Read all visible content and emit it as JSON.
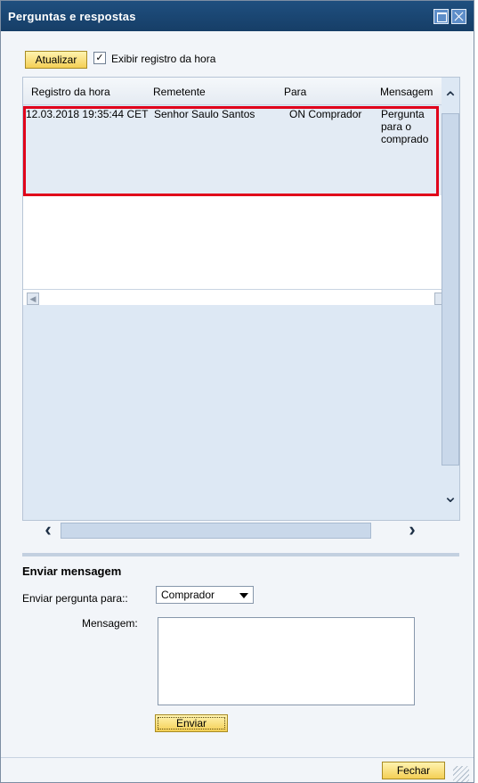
{
  "window": {
    "title": "Perguntas e respostas"
  },
  "toolbar": {
    "refresh_label": "Atualizar",
    "show_timestamp_label": "Exibir registro da hora",
    "show_timestamp_checked": true
  },
  "table": {
    "columns": [
      "Registro da hora",
      "Remetente",
      "Para",
      "Mensagem"
    ],
    "rows": [
      {
        "timestamp": "12.03.2018 19:35:44 CET",
        "sender": "Senhor Saulo Santos",
        "to": "ON Comprador",
        "message": "Pergunta para o comprado"
      }
    ]
  },
  "send_section": {
    "title": "Enviar mensagem",
    "send_to_label": "Enviar pergunta para::",
    "send_to_value": "Comprador",
    "message_label": "Mensagem:",
    "message_value": "",
    "send_label": "Enviar"
  },
  "footer": {
    "close_label": "Fechar"
  }
}
